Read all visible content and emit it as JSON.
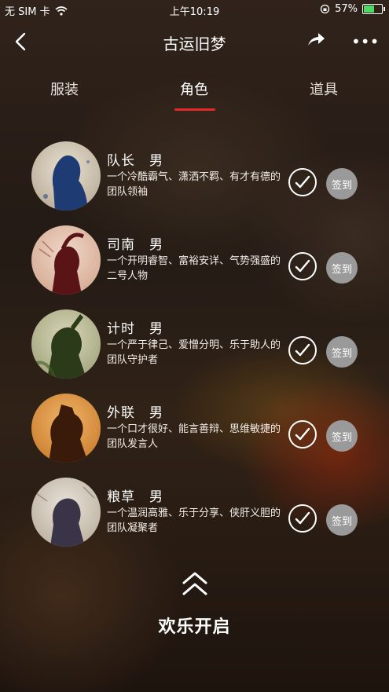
{
  "status_bar": {
    "carrier": "无 SIM 卡",
    "time": "上午10:19",
    "battery": "57%"
  },
  "nav": {
    "title": "古运旧梦"
  },
  "tabs": [
    {
      "label": "服装",
      "selected": false
    },
    {
      "label": "角色",
      "selected": true
    },
    {
      "label": "道具",
      "selected": false
    }
  ],
  "characters": [
    {
      "name": "队长",
      "gender": "男",
      "desc": "一个冷酷霸气、潇洒不羁、有才有德的团队领袖",
      "action": "签到"
    },
    {
      "name": "司南",
      "gender": "男",
      "desc": "一个开明睿智、富裕安详、气势强盛的二号人物",
      "action": "签到"
    },
    {
      "name": "计时",
      "gender": "男",
      "desc": "一个严于律己、爱憎分明、乐于助人的团队守护者",
      "action": "签到"
    },
    {
      "name": "外联",
      "gender": "男",
      "desc": "一个口才很好、能言善辩、思维敏捷的团队发言人",
      "action": "签到"
    },
    {
      "name": "粮草",
      "gender": "男",
      "desc": "一个温润高雅、乐于分享、侠肝义胆的团队凝聚者",
      "action": "签到"
    }
  ],
  "bottom": {
    "start_label": "欢乐开启"
  },
  "colors": {
    "tab_underline": "#e02a2a",
    "signin_bg": "#9a9a9a",
    "battery_fill": "#4cd964"
  }
}
